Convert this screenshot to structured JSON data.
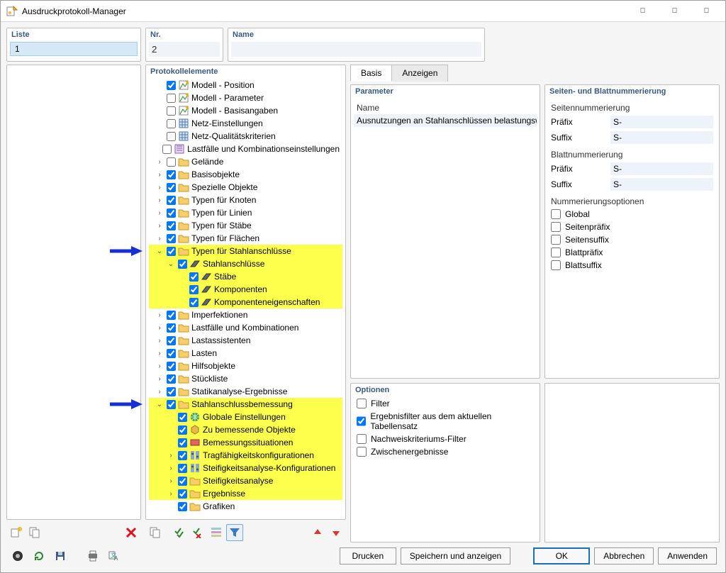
{
  "window": {
    "title": "Ausdruckprotokoll-Manager"
  },
  "liste": {
    "header": "Liste",
    "items": [
      "1"
    ]
  },
  "nr": {
    "header": "Nr.",
    "value": "2"
  },
  "name": {
    "header": "Name",
    "value": ""
  },
  "tree": {
    "header": "Protokollelemente",
    "rows": [
      {
        "lvl": 0,
        "twist": "",
        "chk": true,
        "icon": "model",
        "label": "Modell - Position"
      },
      {
        "lvl": 0,
        "twist": "",
        "chk": false,
        "icon": "model",
        "label": "Modell - Parameter"
      },
      {
        "lvl": 0,
        "twist": "",
        "chk": false,
        "icon": "model",
        "label": "Modell - Basisangaben"
      },
      {
        "lvl": 0,
        "twist": "",
        "chk": false,
        "icon": "mesh",
        "label": "Netz-Einstellungen"
      },
      {
        "lvl": 0,
        "twist": "",
        "chk": false,
        "icon": "mesh",
        "label": "Netz-Qualitätskriterien"
      },
      {
        "lvl": 0,
        "twist": "",
        "chk": false,
        "icon": "load",
        "label": "Lastfälle und Kombinationseinstellungen"
      },
      {
        "lvl": 0,
        "twist": ">",
        "chk": false,
        "icon": "folder",
        "label": "Gelände"
      },
      {
        "lvl": 0,
        "twist": ">",
        "chk": true,
        "icon": "folder",
        "label": "Basisobjekte"
      },
      {
        "lvl": 0,
        "twist": ">",
        "chk": true,
        "icon": "folder",
        "label": "Spezielle Objekte"
      },
      {
        "lvl": 0,
        "twist": ">",
        "chk": true,
        "icon": "folder",
        "label": "Typen für Knoten"
      },
      {
        "lvl": 0,
        "twist": ">",
        "chk": true,
        "icon": "folder",
        "label": "Typen für Linien"
      },
      {
        "lvl": 0,
        "twist": ">",
        "chk": true,
        "icon": "folder",
        "label": "Typen für Stäbe"
      },
      {
        "lvl": 0,
        "twist": ">",
        "chk": true,
        "icon": "folder",
        "label": "Typen für Flächen"
      },
      {
        "lvl": 0,
        "twist": "v",
        "chk": true,
        "icon": "folder",
        "label": "Typen für Stahlanschlüsse",
        "hl": true,
        "arrow": true
      },
      {
        "lvl": 1,
        "twist": "v",
        "chk": true,
        "icon": "steel",
        "label": "Stahlanschlüsse",
        "hl": true
      },
      {
        "lvl": 2,
        "twist": "",
        "chk": true,
        "icon": "steel",
        "label": "Stäbe",
        "hl": true
      },
      {
        "lvl": 2,
        "twist": "",
        "chk": true,
        "icon": "steel",
        "label": "Komponenten",
        "hl": true
      },
      {
        "lvl": 2,
        "twist": "",
        "chk": true,
        "icon": "steel",
        "label": "Komponenteneigenschaften",
        "hl": true
      },
      {
        "lvl": 0,
        "twist": ">",
        "chk": true,
        "icon": "folder",
        "label": "Imperfektionen"
      },
      {
        "lvl": 0,
        "twist": ">",
        "chk": true,
        "icon": "folder",
        "label": "Lastfälle und Kombinationen"
      },
      {
        "lvl": 0,
        "twist": ">",
        "chk": true,
        "icon": "folder",
        "label": "Lastassistenten"
      },
      {
        "lvl": 0,
        "twist": ">",
        "chk": true,
        "icon": "folder",
        "label": "Lasten"
      },
      {
        "lvl": 0,
        "twist": ">",
        "chk": true,
        "icon": "folder",
        "label": "Hilfsobjekte"
      },
      {
        "lvl": 0,
        "twist": ">",
        "chk": true,
        "icon": "folder",
        "label": "Stückliste"
      },
      {
        "lvl": 0,
        "twist": ">",
        "chk": true,
        "icon": "folder",
        "label": "Statikanalyse-Ergebnisse"
      },
      {
        "lvl": 0,
        "twist": "v",
        "chk": true,
        "icon": "folder",
        "label": "Stahlanschlussbemessung",
        "hl": true,
        "arrow": true
      },
      {
        "lvl": 1,
        "twist": "",
        "chk": true,
        "icon": "globe",
        "label": "Globale Einstellungen",
        "hl": true
      },
      {
        "lvl": 1,
        "twist": "",
        "chk": true,
        "icon": "obj",
        "label": "Zu bemessende Objekte",
        "hl": true
      },
      {
        "lvl": 1,
        "twist": "",
        "chk": true,
        "icon": "sit",
        "label": "Bemessungssituationen",
        "hl": true
      },
      {
        "lvl": 1,
        "twist": ">",
        "chk": true,
        "icon": "cfg",
        "label": "Tragfähigkeitskonfigurationen",
        "hl": true
      },
      {
        "lvl": 1,
        "twist": ">",
        "chk": true,
        "icon": "cfg",
        "label": "Steifigkeitsanalyse-Konfigurationen",
        "hl": true
      },
      {
        "lvl": 1,
        "twist": ">",
        "chk": true,
        "icon": "folder",
        "label": "Steifigkeitsanalyse",
        "hl": true
      },
      {
        "lvl": 1,
        "twist": ">",
        "chk": true,
        "icon": "folder",
        "label": "Ergebnisse",
        "hl": true
      },
      {
        "lvl": 1,
        "twist": "",
        "chk": true,
        "icon": "folder",
        "label": "Grafiken"
      }
    ]
  },
  "tabs": {
    "basis": "Basis",
    "anzeigen": "Anzeigen"
  },
  "param": {
    "header": "Parameter",
    "name_label": "Name",
    "name_value": "Ausnutzungen an Stahlanschlüssen belastungsw"
  },
  "seiten": {
    "header": "Seiten- und Blattnummerierung",
    "seitenn": "Seitennummerierung",
    "blattn": "Blattnummerierung",
    "praefix": "Präfix",
    "suffix": "Suffix",
    "seite_prae": "S-",
    "seite_suf": "S-",
    "blatt_prae": "S-",
    "blatt_suf": "S-",
    "numopt": "Nummerierungsoptionen",
    "opts": [
      "Global",
      "Seitenpräfix",
      "Seitensuffix",
      "Blattpräfix",
      "Blattsuffix"
    ]
  },
  "optionen": {
    "header": "Optionen",
    "items": [
      {
        "label": "Filter",
        "chk": false
      },
      {
        "label": "Ergebnisfilter aus dem aktuellen Tabellensatz",
        "chk": true
      },
      {
        "label": "Nachweiskriteriums-Filter",
        "chk": false
      },
      {
        "label": "Zwischenergebnisse",
        "chk": false
      }
    ]
  },
  "footer": {
    "drucken": "Drucken",
    "speichern": "Speichern und anzeigen",
    "ok": "OK",
    "abbrechen": "Abbrechen",
    "anwenden": "Anwenden"
  }
}
